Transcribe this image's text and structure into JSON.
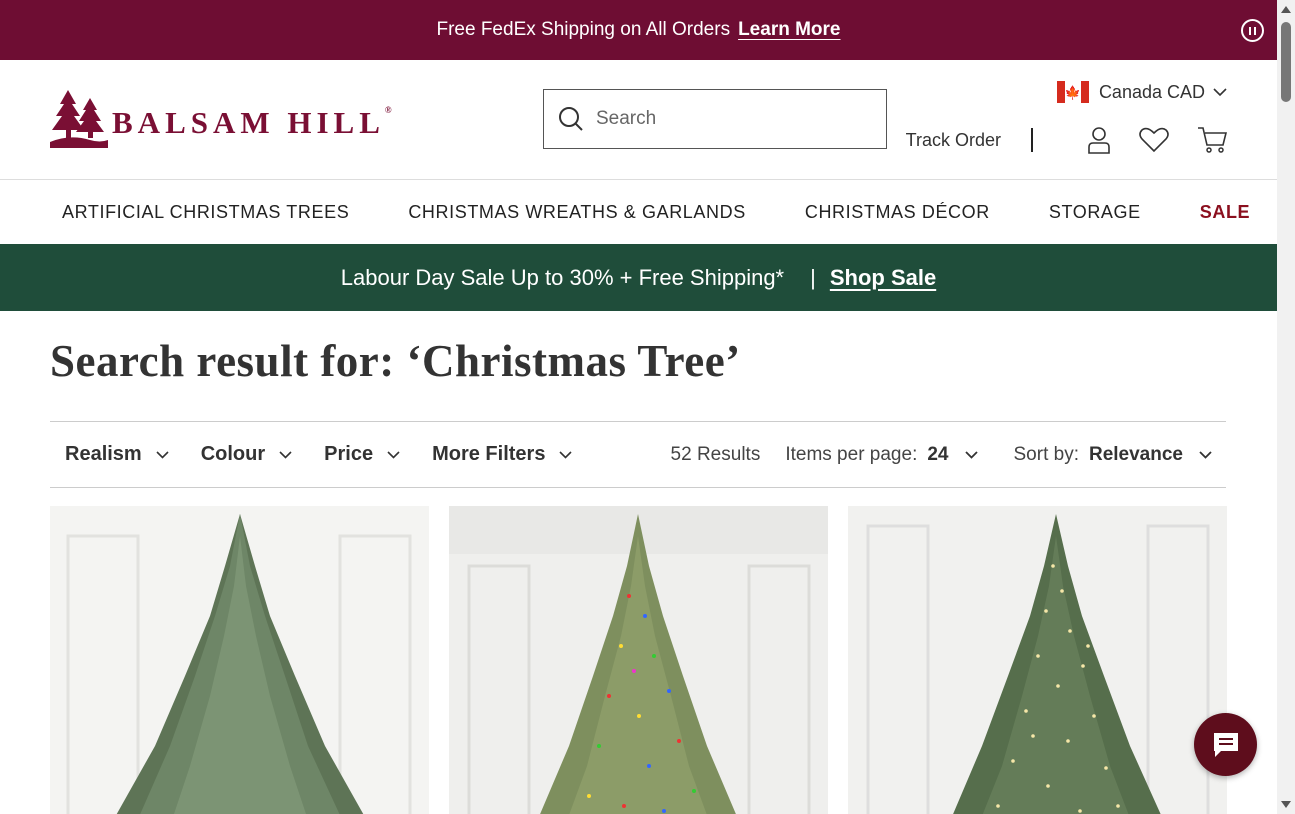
{
  "promo": {
    "text": "Free FedEx Shipping on All Orders",
    "link": "Learn More"
  },
  "header": {
    "logo_text": "BALSAM HILL",
    "logo_reg": "®",
    "search_placeholder": "Search",
    "country": "Canada CAD",
    "track_order": "Track Order"
  },
  "nav": {
    "items": [
      "ARTIFICIAL CHRISTMAS TREES",
      "CHRISTMAS WREATHS & GARLANDS",
      "CHRISTMAS DÉCOR",
      "STORAGE"
    ],
    "sale": "SALE"
  },
  "sale_banner": {
    "text": "Labour Day Sale Up to 30% + Free Shipping*",
    "divider": "|",
    "link": "Shop Sale"
  },
  "results": {
    "title": "Search result for: ‘Christmas Tree’"
  },
  "filters": {
    "items": [
      "Realism",
      "Colour",
      "Price",
      "More Filters"
    ],
    "count": "52 Results",
    "per_page_label": "Items per page:",
    "per_page_value": "24",
    "sort_label": "Sort by:",
    "sort_value": "Relevance"
  },
  "products": [
    {
      "image": "green-christmas-tree-unlit"
    },
    {
      "image": "christmas-tree-multicolor-lights"
    },
    {
      "image": "christmas-tree-clear-lights"
    }
  ],
  "colors": {
    "promo_bg": "#6e0d33",
    "brand": "#7a0f34",
    "sale_banner_bg": "#1f4d3a",
    "sale_nav": "#8b0f1e",
    "chat_bg": "#5e0d1c"
  }
}
